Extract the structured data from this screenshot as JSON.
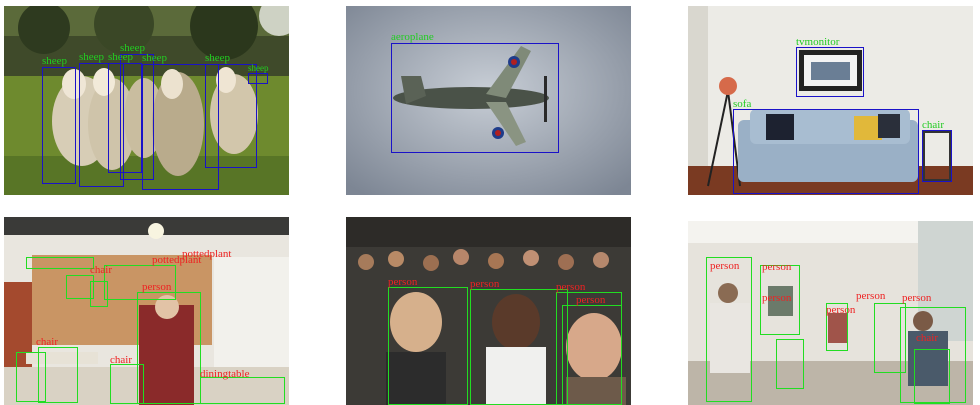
{
  "colors": {
    "box_blue": "#1a12c8",
    "label_green_top": "#22cc22",
    "box_green": "#22dd22",
    "label_red": "#ee2222"
  },
  "panels": [
    {
      "id": "sheep-field",
      "detections": [
        {
          "label": "sheep"
        },
        {
          "label": "sheep"
        },
        {
          "label": "sheep"
        },
        {
          "label": "sheep"
        },
        {
          "label": "sheep"
        },
        {
          "label": "sheep"
        },
        {
          "label": "sheep"
        }
      ]
    },
    {
      "id": "airplane-sky",
      "detections": [
        {
          "label": "aeroplane"
        }
      ]
    },
    {
      "id": "living-room",
      "detections": [
        {
          "label": "tvmonitor"
        },
        {
          "label": "sofa"
        },
        {
          "label": "chair"
        }
      ]
    },
    {
      "id": "cafe-woman",
      "detections": [
        {
          "label": "pottedplant"
        },
        {
          "label": "pottedplant"
        },
        {
          "label": "chair"
        },
        {
          "label": "chair"
        },
        {
          "label": "diningtable"
        },
        {
          "label": "chair"
        },
        {
          "label": "person"
        }
      ]
    },
    {
      "id": "crowd",
      "detections": [
        {
          "label": "person"
        },
        {
          "label": "person"
        },
        {
          "label": "person"
        },
        {
          "label": "person"
        }
      ]
    },
    {
      "id": "restaurant",
      "detections": [
        {
          "label": "person"
        },
        {
          "label": "person"
        },
        {
          "label": "person"
        },
        {
          "label": "person"
        },
        {
          "label": "person"
        },
        {
          "label": "chair"
        },
        {
          "label": "person"
        }
      ]
    }
  ]
}
